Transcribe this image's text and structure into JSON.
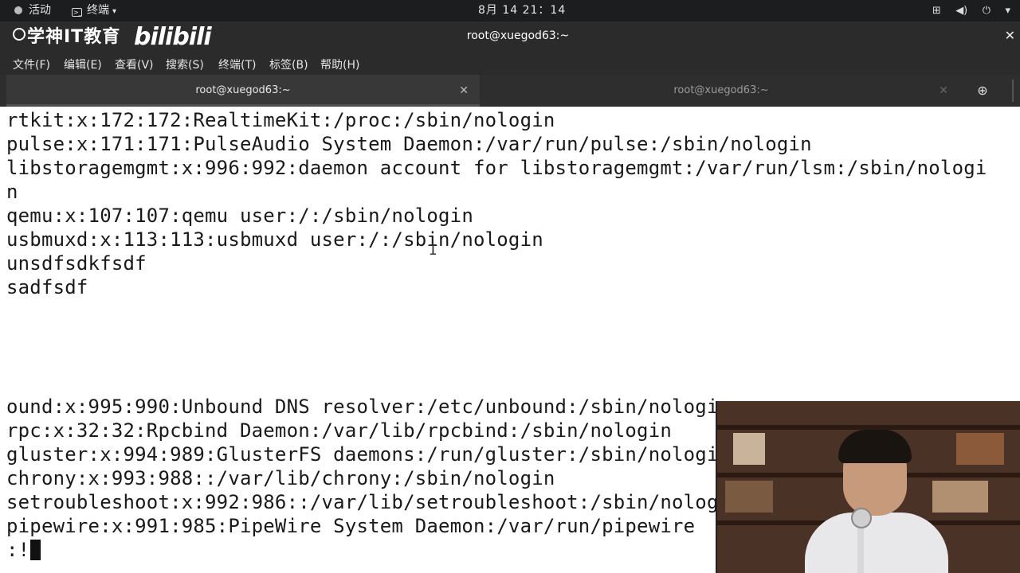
{
  "topbar": {
    "activities_label": "活动",
    "app_menu_label": "终端",
    "clock": "8月 14  21：14",
    "icons": [
      "network-icon",
      "volume-icon",
      "power-icon",
      "dropdown-arrow-icon"
    ]
  },
  "window": {
    "brand_text": "学神IT教育",
    "bili_text": "bilibili",
    "title": "root@xuegod63:~",
    "close_glyph": "✕"
  },
  "menubar": {
    "items": [
      "文件(F)",
      "编辑(E)",
      "查看(V)",
      "搜索(S)",
      "终端(T)",
      "标签(B)",
      "帮助(H)"
    ]
  },
  "tabs": [
    {
      "label": "root@xuegod63:~",
      "active": true
    },
    {
      "label": "root@xuegod63:~",
      "active": false
    }
  ],
  "terminal": {
    "lines": [
      "rtkit:x:172:172:RealtimeKit:/proc:/sbin/nologin",
      "pulse:x:171:171:PulseAudio System Daemon:/var/run/pulse:/sbin/nologin",
      "libstoragemgmt:x:996:992:daemon account for libstoragemgmt:/var/run/lsm:/sbin/nologi",
      "n",
      "qemu:x:107:107:qemu user:/:/sbin/nologin",
      "usbmuxd:x:113:113:usbmuxd user:/:/sbin/nologin",
      "unsdfsdkfsdf",
      "sadfsdf",
      "",
      "",
      "",
      "ound:x:995:990:Unbound DNS resolver:/etc/unbound:/sbin/nologin",
      "rpc:x:32:32:Rpcbind Daemon:/var/lib/rpcbind:/sbin/nologin",
      "gluster:x:994:989:GlusterFS daemons:/run/gluster:/sbin/nologin",
      "chrony:x:993:988::/var/lib/chrony:/sbin/nologin",
      "setroubleshoot:x:992:986::/var/lib/setroubleshoot:/sbin/nologin",
      "pipewire:x:991:985:PipeWire System Daemon:/var/run/pipewire"
    ],
    "prompt": ":!"
  },
  "colors": {
    "topbar_bg": "#1b1d1e",
    "header_bg": "#2b2b2b",
    "terminal_bg": "#ffffff",
    "terminal_fg": "#1a1a1a"
  }
}
